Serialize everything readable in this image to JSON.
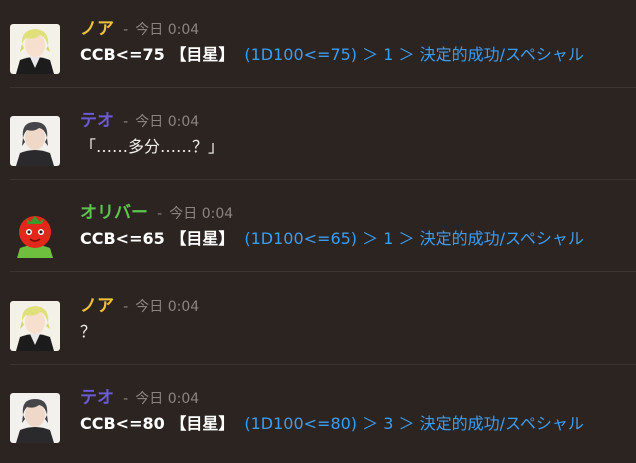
{
  "colors": {
    "background": "#2b2421",
    "noa": "#f0c23c",
    "teo": "#6b5bd0",
    "oliver": "#5ec44e",
    "dice_result": "#3e9cf0",
    "meta": "#8c8480"
  },
  "messages": [
    {
      "speaker": "ノア",
      "separator": "-",
      "time": "今日 0:04",
      "command": "CCB<=75 【目星】",
      "result": "(1D100<=75) ＞ 1 ＞ 決定的成功/スペシャル"
    },
    {
      "speaker": "テオ",
      "separator": "-",
      "time": "今日 0:04",
      "text": "「……多分……？」"
    },
    {
      "speaker": "オリバー",
      "separator": "-",
      "time": "今日 0:04",
      "command": "CCB<=65 【目星】",
      "result": "(1D100<=65) ＞ 1 ＞ 決定的成功/スペシャル"
    },
    {
      "speaker": "ノア",
      "separator": "-",
      "time": "今日 0:04",
      "text": "？"
    },
    {
      "speaker": "テオ",
      "separator": "-",
      "time": "今日 0:04",
      "command": "CCB<=80 【目星】",
      "result": "(1D100<=80) ＞ 3 ＞ 決定的成功/スペシャル"
    }
  ]
}
